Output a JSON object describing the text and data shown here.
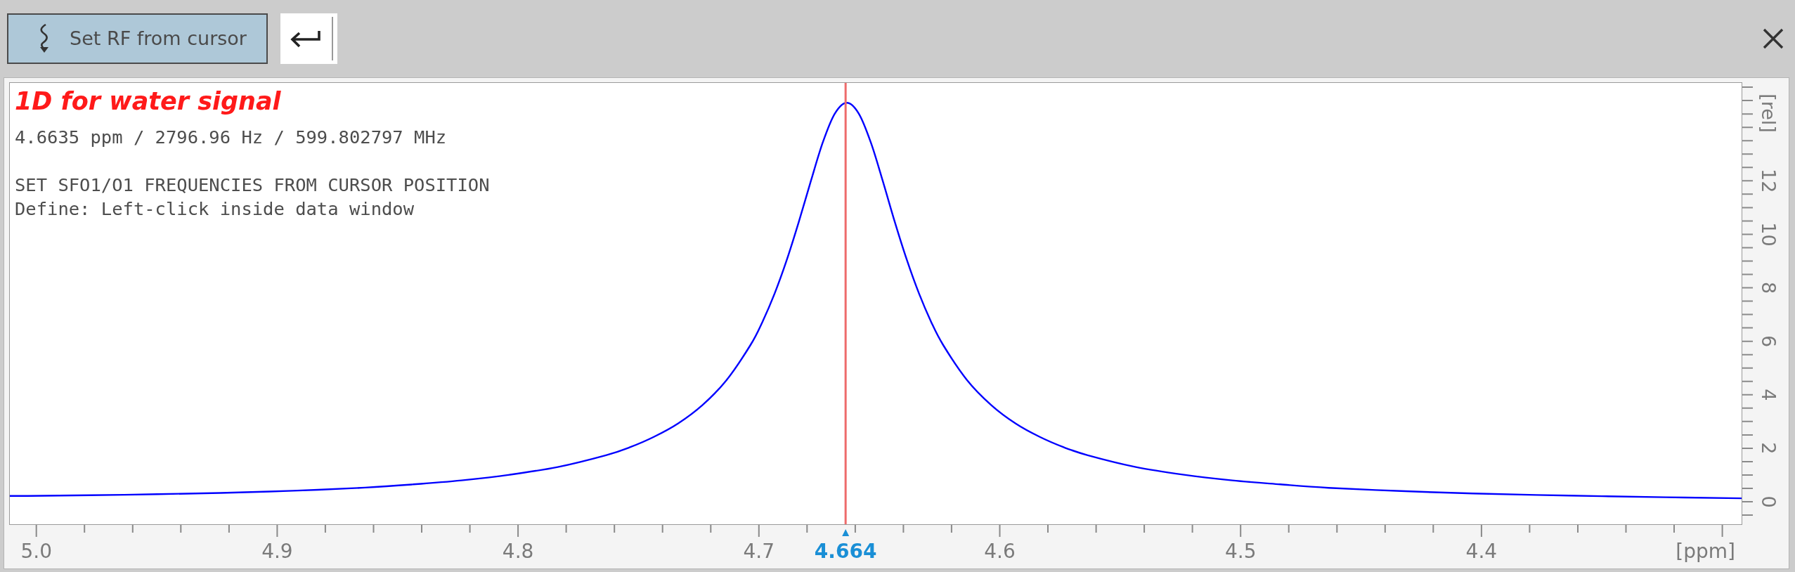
{
  "toolbar": {
    "set_rf_button": {
      "label": "Set RF from cursor"
    }
  },
  "spectrum": {
    "title": "1D for water signal",
    "cursor_readout": "4.6635 ppm / 2796.96 Hz / 599.802797 MHz",
    "instructions": [
      "SET SFO1/O1 FREQUENCIES FROM CURSOR POSITION",
      "Define: Left-click inside data window"
    ],
    "chart_data": {
      "type": "line",
      "xlabel": "[ppm]",
      "ylabel": "[rel]",
      "x": [
        5.011,
        5.0035,
        4.9635,
        4.9235,
        4.8935,
        4.8635,
        4.8435,
        4.8235,
        4.8035,
        4.7835,
        4.7635,
        4.7535,
        4.7435,
        4.7335,
        4.7235,
        4.7135,
        4.7035,
        4.6985,
        4.6935,
        4.6885,
        4.6835,
        4.6785,
        4.6735,
        4.6685,
        4.6635,
        4.6585,
        4.6535,
        4.6485,
        4.6435,
        4.6385,
        4.6335,
        4.6285,
        4.6235,
        4.6135,
        4.6035,
        4.5935,
        4.5835,
        4.5735,
        4.5635,
        4.5435,
        4.5235,
        4.5035,
        4.4835,
        4.4635,
        4.4335,
        4.4035,
        4.3635,
        4.3235,
        4.292
      ],
      "series": [
        {
          "color": "#0000ff",
          "values": [
            0.22,
            0.22,
            0.26,
            0.33,
            0.41,
            0.53,
            0.65,
            0.8,
            1.01,
            1.3,
            1.74,
            2.04,
            2.43,
            2.93,
            3.61,
            4.54,
            5.86,
            6.73,
            7.78,
            9.02,
            10.44,
            11.97,
            13.43,
            14.51,
            14.92,
            14.51,
            13.43,
            11.97,
            10.44,
            9.02,
            7.78,
            6.73,
            5.86,
            4.54,
            3.61,
            2.93,
            2.43,
            2.04,
            1.74,
            1.3,
            1.01,
            0.8,
            0.65,
            0.52,
            0.4,
            0.31,
            0.23,
            0.17,
            0.13
          ]
        }
      ],
      "xlim": [
        5.011,
        4.292
      ],
      "ylim": [
        -0.84,
        15.66
      ],
      "xticks": [
        {
          "value": 5.0,
          "label": "5.0"
        },
        {
          "value": 4.9,
          "label": "4.9"
        },
        {
          "value": 4.8,
          "label": "4.8"
        },
        {
          "value": 4.7,
          "label": "4.7"
        },
        {
          "value": 4.6,
          "label": "4.6"
        },
        {
          "value": 4.5,
          "label": "4.5"
        },
        {
          "value": 4.4,
          "label": "4.4"
        }
      ],
      "yticks": [
        0,
        2,
        4,
        6,
        8,
        10,
        12
      ],
      "ref_lines": [
        {
          "axis": "x",
          "value": 4.664,
          "label": "4.664",
          "color": "#ee6b6b"
        }
      ]
    }
  }
}
